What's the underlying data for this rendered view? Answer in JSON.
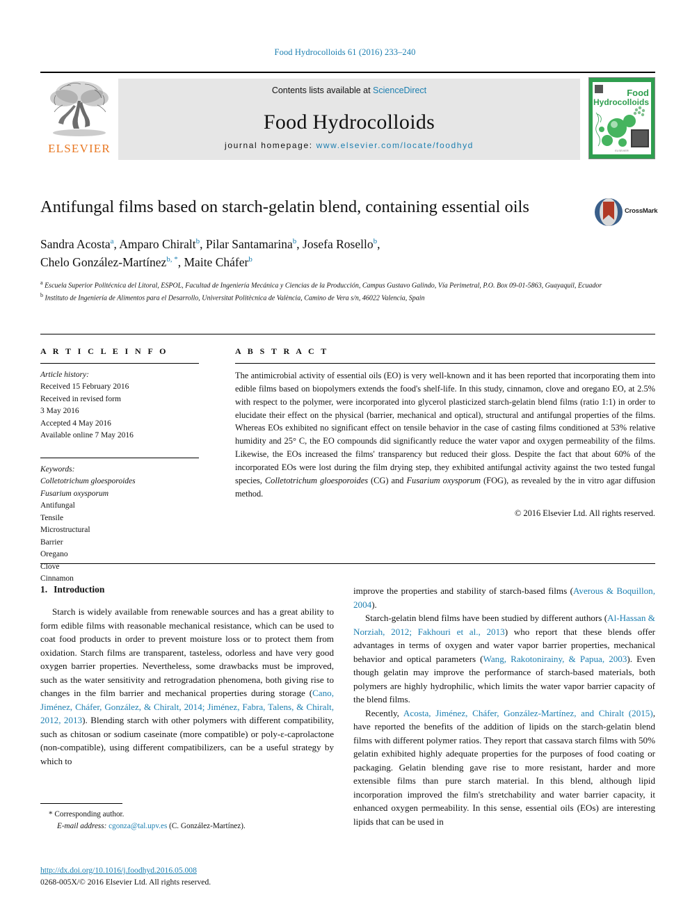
{
  "running_head": "Food Hydrocolloids 61 (2016) 233–240",
  "masthead": {
    "publisher_name": "ELSEVIER",
    "contents_prefix": "Contents lists available at ",
    "contents_link": "ScienceDirect",
    "journal_name": "Food Hydrocolloids",
    "homepage_prefix": "journal homepage: ",
    "homepage_url": "www.elsevier.com/locate/foodhyd",
    "cover_title_line1": "Food",
    "cover_title_line2": "Hydrocolloids"
  },
  "article": {
    "title": "Antifungal films based on starch-gelatin blend, containing essential oils",
    "crossmark_label": "CrossMark",
    "authors": [
      {
        "name": "Sandra Acosta",
        "marks": "a"
      },
      {
        "name": "Amparo Chiralt",
        "marks": "b"
      },
      {
        "name": "Pilar Santamarina",
        "marks": "b"
      },
      {
        "name": "Josefa Rosello",
        "marks": "b"
      },
      {
        "name": "Chelo González-Martínez",
        "marks": "b, *"
      },
      {
        "name": "Maite Cháfer",
        "marks": "b"
      }
    ],
    "affiliations": [
      {
        "mark": "a",
        "text": "Escuela Superior Politécnica del Litoral, ESPOL, Facultad de Ingeniería Mecánica y Ciencias de la Producción, Campus Gustavo Galindo, Vía Perimetral, P.O. Box 09-01-5863, Guayaquil, Ecuador"
      },
      {
        "mark": "b",
        "text": "Instituto de Ingeniería de Alimentos para el Desarrollo, Universitat Politècnica de València, Camino de Vera s/n, 46022 Valencia, Spain"
      }
    ]
  },
  "article_info": {
    "heading": "A R T I C L E   I N F O",
    "history_label": "Article history:",
    "history": [
      "Received 15 February 2016",
      "Received in revised form",
      "3 May 2016",
      "Accepted 4 May 2016",
      "Available online 7 May 2016"
    ],
    "keywords_label": "Keywords:",
    "keywords": [
      {
        "text": "Colletotrichum gloesporoides",
        "italic": true
      },
      {
        "text": "Fusarium oxysporum",
        "italic": true
      },
      {
        "text": "Antifungal",
        "italic": false
      },
      {
        "text": "Tensile",
        "italic": false
      },
      {
        "text": "Microstructural",
        "italic": false
      },
      {
        "text": "Barrier",
        "italic": false
      },
      {
        "text": "Oregano",
        "italic": false
      },
      {
        "text": "Clove",
        "italic": false
      },
      {
        "text": "Cinnamon",
        "italic": false
      }
    ]
  },
  "abstract": {
    "heading": "A B S T R A C T",
    "part1": "The antimicrobial activity of essential oils (EO) is very well-known and it has been reported that incorporating them into edible films based on biopolymers extends the food's shelf-life. In this study, cinnamon, clove and oregano EO, at 2.5% with respect to the polymer, were incorporated into glycerol plasticized starch-gelatin blend films (ratio 1:1) in order to elucidate their effect on the physical (barrier, mechanical and optical), structural and antifungal properties of the films. Whereas EOs exhibited no significant effect on tensile behavior in the case of casting films conditioned at 53% relative humidity and 25° C, the EO compounds did significantly reduce the water vapor and oxygen permeability of the films. Likewise, the EOs increased the films' transparency but reduced their gloss. Despite the fact that about 60% of the incorporated EOs were lost during the film drying step, they exhibited antifungal activity against the two tested fungal species, ",
    "species1": "Colletotrichum gloesporoides",
    "mid": " (CG) and ",
    "species2": "Fusarium oxysporum",
    "part2": " (FOG), as revealed by the in vitro agar diffusion method.",
    "copyright": "© 2016 Elsevier Ltd. All rights reserved."
  },
  "introduction": {
    "section_number": "1.",
    "section_title": "Introduction",
    "left_p1": "Starch is widely available from renewable sources and has a great ability to form edible films with reasonable mechanical resistance, which can be used to coat food products in order to prevent moisture loss or to protect them from oxidation. Starch films are transparent, tasteless, odorless and have very good oxygen barrier properties. Nevertheless, some drawbacks must be improved, such as the water sensitivity and retrogradation phenomena, both giving rise to changes in the film barrier and mechanical properties during storage (",
    "left_cite1": "Cano, Jiménez, Cháfer, González, & Chiralt, 2014; Jiménez, Fabra, Talens, & Chiralt, 2012, 2013",
    "left_p1b": "). Blending starch with other polymers with different compatibility, such as chitosan or sodium caseinate (more compatible) or poly-ε-caprolactone (non-compatible), using different compatibilizers, can be a useful strategy by which to",
    "right_p1a": "improve the properties and stability of starch-based films (",
    "right_cite1": "Averous & Boquillon, 2004",
    "right_p1b": ").",
    "right_p2a": "Starch-gelatin blend films have been studied by different authors (",
    "right_cite2": "Al-Hassan & Norziah, 2012; Fakhouri et al., 2013",
    "right_p2b": ") who report that these blends offer advantages in terms of oxygen and water vapor barrier properties, mechanical behavior and optical parameters (",
    "right_cite3": "Wang, Rakotonirainy, & Papua, 2003",
    "right_p2c": "). Even though gelatin may improve the performance of starch-based materials, both polymers are highly hydrophilic, which limits the water vapor barrier capacity of the blend films.",
    "right_p3a": "Recently, ",
    "right_cite4": "Acosta, Jiménez, Cháfer, González-Martínez, and Chiralt (2015)",
    "right_p3b": ", have reported the benefits of the addition of lipids on the starch-gelatin blend films with different polymer ratios. They report that cassava starch films with 50% gelatin exhibited highly adequate properties for the purposes of food coating or packaging. Gelatin blending gave rise to more resistant, harder and more extensible films than pure starch material. In this blend, although lipid incorporation improved the film's stretchability and water barrier capacity, it enhanced oxygen permeability. In this sense, essential oils (EOs) are interesting lipids that can be used in"
  },
  "footnote": {
    "corresponding_marker": "*",
    "corresponding_label": "Corresponding author.",
    "email_label": "E-mail address:",
    "email": "cgonza@tal.upv.es",
    "email_owner": "(C. González-Martínez)."
  },
  "footer": {
    "doi": "http://dx.doi.org/10.1016/j.foodhyd.2016.05.008",
    "issn_line": "0268-005X/© 2016 Elsevier Ltd. All rights reserved."
  },
  "colors": {
    "link_blue": "#1b7eb0",
    "elsevier_orange": "#e87722",
    "masthead_grey": "#e6e6e6",
    "cover_green": "#2f9e4f"
  }
}
